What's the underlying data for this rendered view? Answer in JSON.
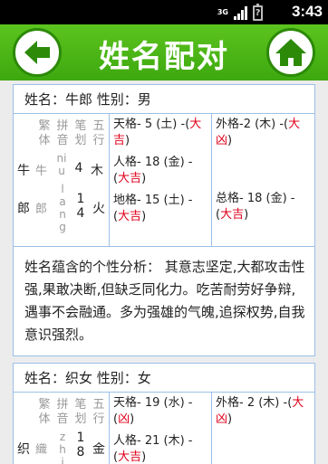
{
  "status_bar": {
    "network": "3G",
    "battery_glyph": "?",
    "time": "3:43"
  },
  "header": {
    "title": "姓名配对",
    "back_icon": "arrow-left-icon",
    "home_icon": "home-icon"
  },
  "cards": [
    {
      "name_line": "姓名：牛郎 性别：男",
      "column_headers": [
        [
          "繁",
          "体"
        ],
        [
          "拼",
          "音"
        ],
        [
          "笔",
          "划"
        ],
        [
          "五",
          "行"
        ]
      ],
      "chars": [
        {
          "simp": "牛",
          "trad": "牛",
          "pinyin": "niu",
          "strokes": "4",
          "element": "木"
        },
        {
          "simp": "郎",
          "trad": "郎",
          "pinyin": "lang",
          "strokes": "14",
          "element": "火"
        }
      ],
      "tian": {
        "label": "天格- 5 (土) -(",
        "luck": "大吉",
        "close": ")"
      },
      "ren": {
        "label": "人格- 18 (金) -(",
        "luck": "大吉",
        "close": ")"
      },
      "di": {
        "label": "地格- 15 (土) -(",
        "luck": "大吉",
        "close": ")"
      },
      "wai": {
        "label": "外格-2 (木) -(",
        "luck": "大凶",
        "close": ")"
      },
      "zong": {
        "label": "总格- 18 (金) -(",
        "luck": "大吉",
        "close": ")"
      },
      "analysis": "姓名蕴含的个性分析： 其意志坚定,大都攻击性强,果敢决断,但缺乏同化力。吃苦耐劳好争辩,遇事不会融通。多为强雄的气魄,追探权势,自我意识强烈。"
    },
    {
      "name_line": "姓名：织女 性别：女",
      "chars": [
        {
          "simp": "织",
          "trad": "織",
          "pinyin": "zhi",
          "strokes": "18",
          "element": "金"
        }
      ],
      "tian": {
        "label": "天格- 19 (水) -(",
        "luck": "凶",
        "close": ")"
      },
      "ren": {
        "label": "人格- 21 (木) -(",
        "luck": "大吉",
        "close": ")"
      },
      "wai": {
        "label": "外格- 2 (木) -(",
        "luck": "大凶",
        "close": ")"
      }
    }
  ],
  "colors": {
    "header_green": "#4cb317",
    "luck_red": "#e0001b",
    "border_blue": "#9bc0e8"
  }
}
